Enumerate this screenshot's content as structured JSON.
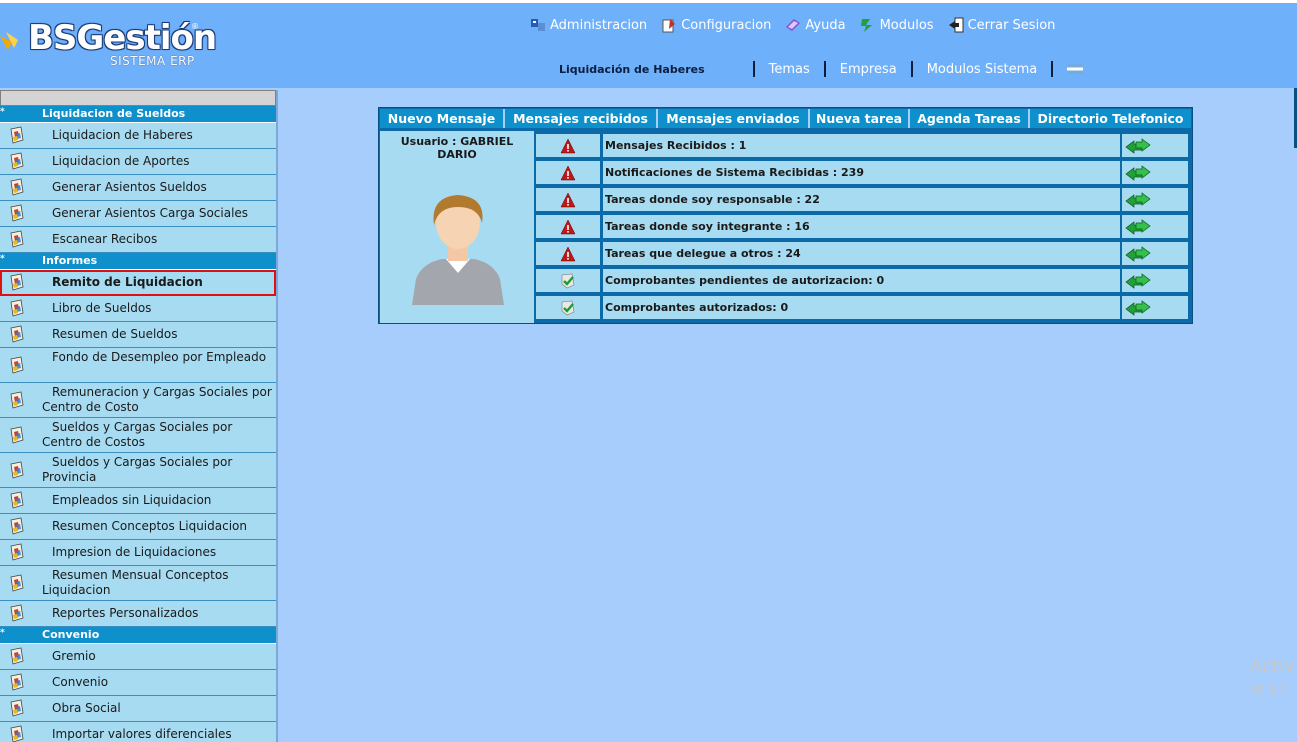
{
  "app": {
    "brand": "BSGestión",
    "brand_sub": "SISTEMA ERP",
    "registered": "®"
  },
  "topnav": [
    {
      "label": "Administracion",
      "icon": "admin-icon"
    },
    {
      "label": "Configuracion",
      "icon": "config-icon"
    },
    {
      "label": "Ayuda",
      "icon": "help-icon"
    },
    {
      "label": "Modulos",
      "icon": "modules-icon"
    },
    {
      "label": "Cerrar Sesion",
      "icon": "logout-icon"
    }
  ],
  "subnav": {
    "current": "Liquidación de Haberes",
    "links": [
      "Temas",
      "Empresa",
      "Modulos Sistema"
    ],
    "flag_icon": "argentina-flag-icon"
  },
  "sidebar": {
    "sections": [
      {
        "title": "Liquidacion de Sueldos",
        "items": [
          {
            "label": "Liquidacion de Haberes"
          },
          {
            "label": "Liquidacion de Aportes"
          },
          {
            "label": "Generar Asientos Sueldos"
          },
          {
            "label": "Generar Asientos Carga Sociales"
          },
          {
            "label": "Escanear Recibos"
          }
        ]
      },
      {
        "title": "Informes",
        "items": [
          {
            "label": "Remito de Liquidacion",
            "selected": true
          },
          {
            "label": "Libro de Sueldos"
          },
          {
            "label": "Resumen de Sueldos"
          },
          {
            "label": "Fondo de Desempleo por Empleado"
          },
          {
            "label": "Remuneracion y Cargas Sociales por Centro de Costo"
          },
          {
            "label": "Sueldos y Cargas Sociales por Centro de Costos"
          },
          {
            "label": "Sueldos y Cargas Sociales por Provincia"
          },
          {
            "label": "Empleados sin Liquidacion"
          },
          {
            "label": "Resumen Conceptos Liquidacion"
          },
          {
            "label": "Impresion de Liquidaciones"
          },
          {
            "label": "Resumen Mensual Conceptos Liquidacion"
          },
          {
            "label": "Reportes Personalizados"
          }
        ]
      },
      {
        "title": "Convenio",
        "items": [
          {
            "label": "Gremio"
          },
          {
            "label": "Convenio"
          },
          {
            "label": "Obra Social"
          },
          {
            "label": "Importar valores diferenciales"
          }
        ]
      }
    ]
  },
  "panel": {
    "tabs": [
      "Nuevo Mensaje",
      "Mensajes recibidos",
      "Mensajes enviados",
      "Nueva tarea",
      "Agenda Tareas",
      "Directorio Telefonico"
    ],
    "user_label": "Usuario : GABRIEL DARIO",
    "rows": [
      {
        "status": "warning",
        "text": "Mensajes Recibidos : 1"
      },
      {
        "status": "warning",
        "text": "Notificaciones de Sistema Recibidas : 239"
      },
      {
        "status": "warning",
        "text": "Tareas donde soy responsable : 22"
      },
      {
        "status": "warning",
        "text": "Tareas donde soy integrante : 16"
      },
      {
        "status": "warning",
        "text": "Tareas que delegue a otros : 24"
      },
      {
        "status": "ok",
        "text": "Comprobantes pendientes de autorizacion: 0"
      },
      {
        "status": "ok",
        "text": "Comprobantes autorizados: 0"
      }
    ]
  },
  "watermark": {
    "line1": "Activ",
    "line2": "Ve a C"
  },
  "colors": {
    "header": "#6fb0fb",
    "background": "#a6cdfb",
    "section": "#0d90cc",
    "item": "#a6dbf2",
    "selected_outline": "#e01010"
  }
}
